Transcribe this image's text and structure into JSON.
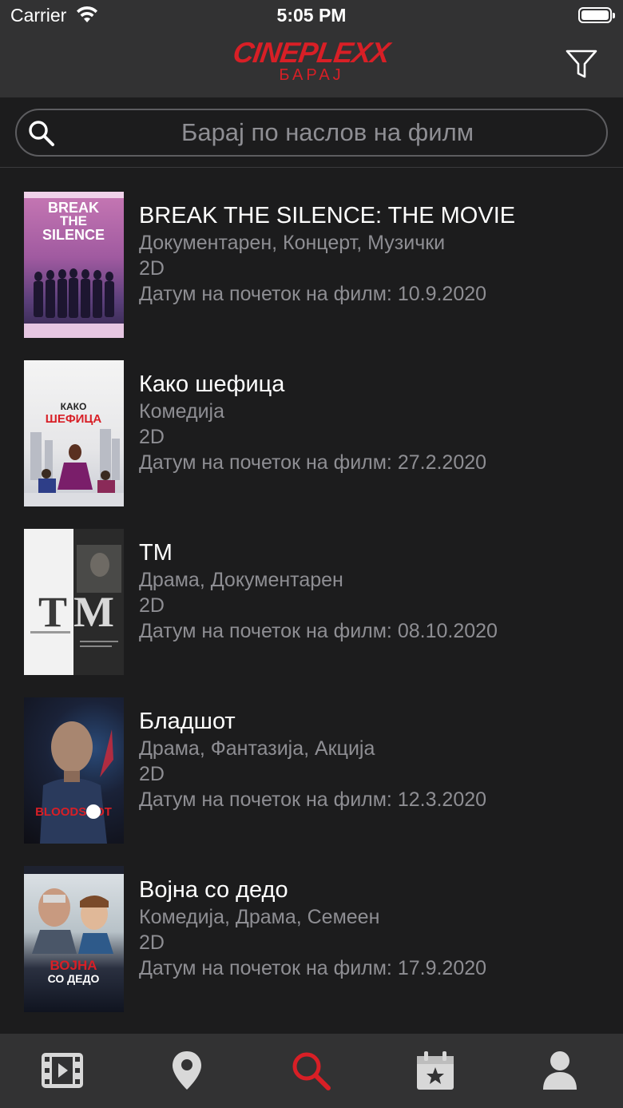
{
  "status_bar": {
    "carrier": "Carrier",
    "time": "5:05 PM"
  },
  "nav": {
    "brand": "CINEPLEXX",
    "subtitle": "БАРАЈ",
    "filter_icon": "filter-icon",
    "brand_color": "#d81f26"
  },
  "search": {
    "placeholder": "Барај по наслов на филм",
    "value": "",
    "icon": "search-icon"
  },
  "movies": [
    {
      "title": "BREAK THE SILENCE: THE MOVIE",
      "genres": "Документарен, Концерт, Музички",
      "format": "2D",
      "start_date": "Датум на почеток на филм: 10.9.2020",
      "poster_text": "BREAK THE SILENCE"
    },
    {
      "title": "Како шефица",
      "genres": "Комедија",
      "format": "2D",
      "start_date": "Датум на почеток на филм: 27.2.2020",
      "poster_text": "КАКО ШЕФИЦА"
    },
    {
      "title": "TM",
      "genres": "Драма, Документарен",
      "format": "2D",
      "start_date": "Датум на почеток на филм: 08.10.2020",
      "poster_text": "TM"
    },
    {
      "title": "Бладшот",
      "genres": "Драма, Фантазија, Акција",
      "format": "2D",
      "start_date": "Датум на почеток на филм: 12.3.2020",
      "poster_text": "BLOODSHOT"
    },
    {
      "title": "Војна со дедо",
      "genres": "Комедија, Драма, Семеен",
      "format": "2D",
      "start_date": "Датум на почеток на филм: 17.9.2020",
      "poster_text": "ВОЈНА СО ДЕДО"
    }
  ],
  "tabs": [
    {
      "icon": "film-icon",
      "active": false
    },
    {
      "icon": "location-pin-icon",
      "active": false
    },
    {
      "icon": "search-icon",
      "active": true
    },
    {
      "icon": "calendar-star-icon",
      "active": false
    },
    {
      "icon": "user-icon",
      "active": false
    }
  ],
  "colors": {
    "background": "#1c1c1d",
    "bar": "#323233",
    "accent": "#d81f26",
    "secondary_text": "#8e8e93"
  }
}
